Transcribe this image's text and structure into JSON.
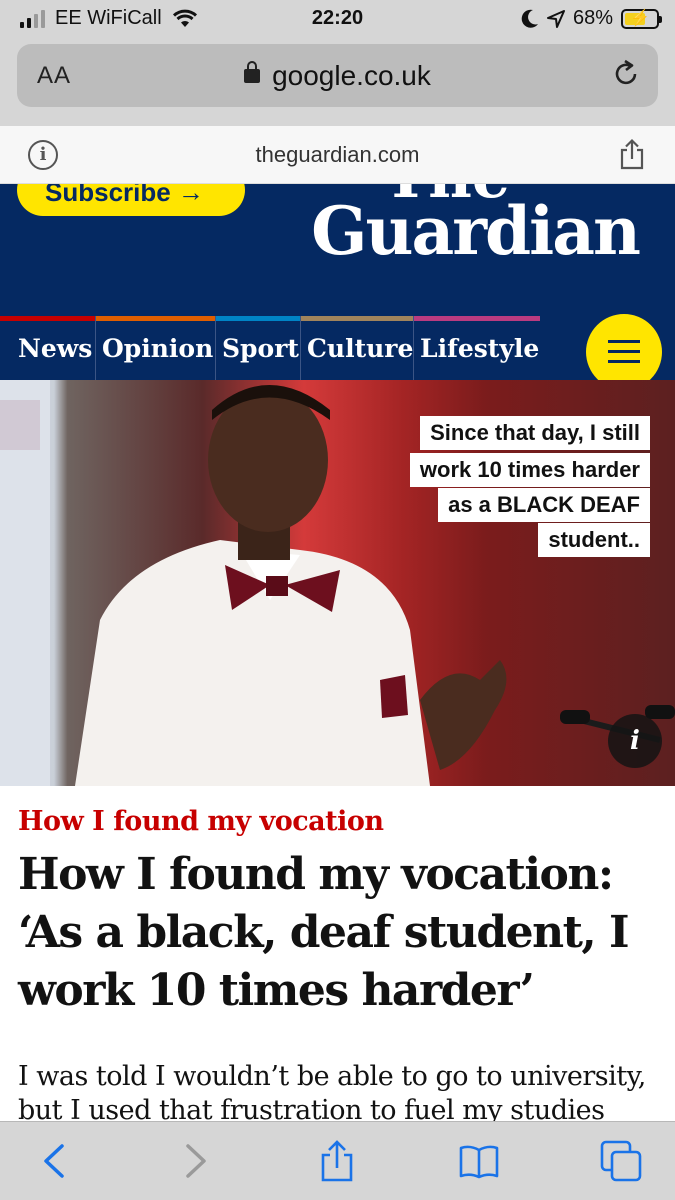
{
  "status_bar": {
    "carrier": "EE WiFiCall",
    "time": "22:20",
    "battery_percent": "68%"
  },
  "browser": {
    "text_size_label": "AA",
    "url": "google.co.uk",
    "amp_domain": "theguardian.com"
  },
  "header": {
    "subscribe_label": "Subscribe →",
    "logo_top": "The",
    "logo_main": "Guardian",
    "pillars": [
      {
        "label": "News",
        "color": "#c70000"
      },
      {
        "label": "Opinion",
        "color": "#e05e00"
      },
      {
        "label": "Sport",
        "color": "#0084c6"
      },
      {
        "label": "Culture",
        "color": "#a1845c"
      },
      {
        "label": "Lifestyle",
        "color": "#bb3b80"
      }
    ]
  },
  "photo": {
    "overlay_lines": [
      "Since that day, I still",
      "work 10 times harder",
      "as a BLACK DEAF",
      "student.."
    ],
    "info_label": "i"
  },
  "article": {
    "kicker": "How I found my vocation",
    "headline": "How I found my vocation: ‘As a black, deaf student, I work 10 times harder’",
    "standfirst": "I was told I wouldn’t be able to go to university, but I used that frustration to fuel my studies"
  },
  "toolbar": {
    "icons": [
      "back-icon",
      "forward-icon",
      "share-icon",
      "bookmarks-icon",
      "tabs-icon"
    ],
    "accent": "#1a73e8"
  }
}
